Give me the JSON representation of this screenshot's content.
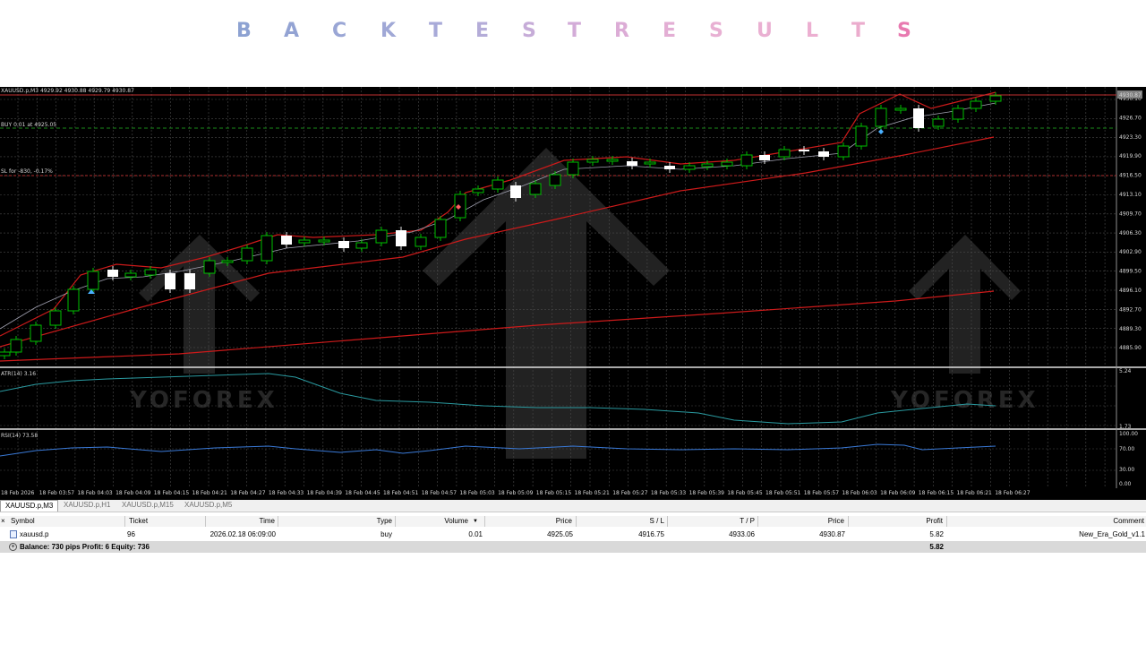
{
  "title": {
    "letters": [
      "B",
      "A",
      "C",
      "K",
      "T",
      "E",
      "S",
      "T",
      "R",
      "E",
      "S",
      "U",
      "L",
      "T",
      "S"
    ],
    "colors": [
      "#8da2d2",
      "#93a3d3",
      "#9aa6d5",
      "#a0a8d6",
      "#a8aad8",
      "#b4acd8",
      "#c6acd8",
      "#d3acd8",
      "#dcacd6",
      "#e3aed4",
      "#e8b0d3",
      "#eab0d2",
      "#ecafd1",
      "#ebaccd",
      "#e87ab0"
    ]
  },
  "chart": {
    "symbol_info": "XAUUSD.p,M3  4929.92 4930.88 4929.79 4930.87",
    "buy_label": "BUY 0.01 at 4925.05",
    "sl_label": "SL for -830, -0.17%",
    "current_price_label": "4930.87",
    "price_ticks": [
      "4930.10",
      "4926.70",
      "4923.30",
      "4919.90",
      "4916.50",
      "4913.10",
      "4909.70",
      "4906.30",
      "4902.90",
      "4899.50",
      "4896.10",
      "4892.70",
      "4889.30",
      "4885.90"
    ],
    "atr_label": "ATR(14) 3.16",
    "atr_ticks": [
      "5.24",
      "1.73"
    ],
    "rsi_label": "RSI(14) 73.58",
    "rsi_ticks": [
      "100.00",
      "70.00",
      "30.00",
      "0.00"
    ],
    "time_ticks": [
      "18 Feb 2026",
      "18 Feb 03:57",
      "18 Feb 04:03",
      "18 Feb 04:09",
      "18 Feb 04:15",
      "18 Feb 04:21",
      "18 Feb 04:27",
      "18 Feb 04:33",
      "18 Feb 04:39",
      "18 Feb 04:45",
      "18 Feb 04:51",
      "18 Feb 04:57",
      "18 Feb 05:03",
      "18 Feb 05:09",
      "18 Feb 05:15",
      "18 Feb 05:21",
      "18 Feb 05:27",
      "18 Feb 05:33",
      "18 Feb 05:39",
      "18 Feb 05:45",
      "18 Feb 05:51",
      "18 Feb 05:57",
      "18 Feb 06:03",
      "18 Feb 06:09",
      "18 Feb 06:15",
      "18 Feb 06:21",
      "18 Feb 06:27"
    ],
    "watermark": "YOFOREX",
    "colors": {
      "bull": "#00c000",
      "bear": "#ffffff",
      "ma_red": "#cc1a1a",
      "atr": "#2a9aa0",
      "rsi": "#3a7ad8",
      "buy_line": "#1a8a1a",
      "sl_line": "#b03030"
    }
  },
  "tabs": [
    "XAUUSD.p,M3",
    "XAUUSD.p,H1",
    "XAUUSD.p,M15",
    "XAUUSD.p,M5"
  ],
  "terminal": {
    "close_icon": "×",
    "headers": {
      "symbol": "Symbol",
      "ticket": "Ticket",
      "time": "Time",
      "type": "Type",
      "volume": "Volume",
      "price": "Price",
      "sl": "S / L",
      "tp": "T / P",
      "price2": "Price",
      "profit": "Profit",
      "comment": "Comment"
    },
    "trade": {
      "symbol": "xauusd.p",
      "ticket": "96",
      "time": "2026.02.18 06:09:00",
      "type": "buy",
      "volume": "0.01",
      "price": "4925.05",
      "sl": "4916.75",
      "tp": "4933.06",
      "price2": "4930.87",
      "profit": "5.82",
      "comment": "New_Era_Gold_v1.1"
    },
    "balance_text": "Balance: 730 pips   Profit: 6   Equity: 736",
    "balance_profit": "5.82"
  }
}
